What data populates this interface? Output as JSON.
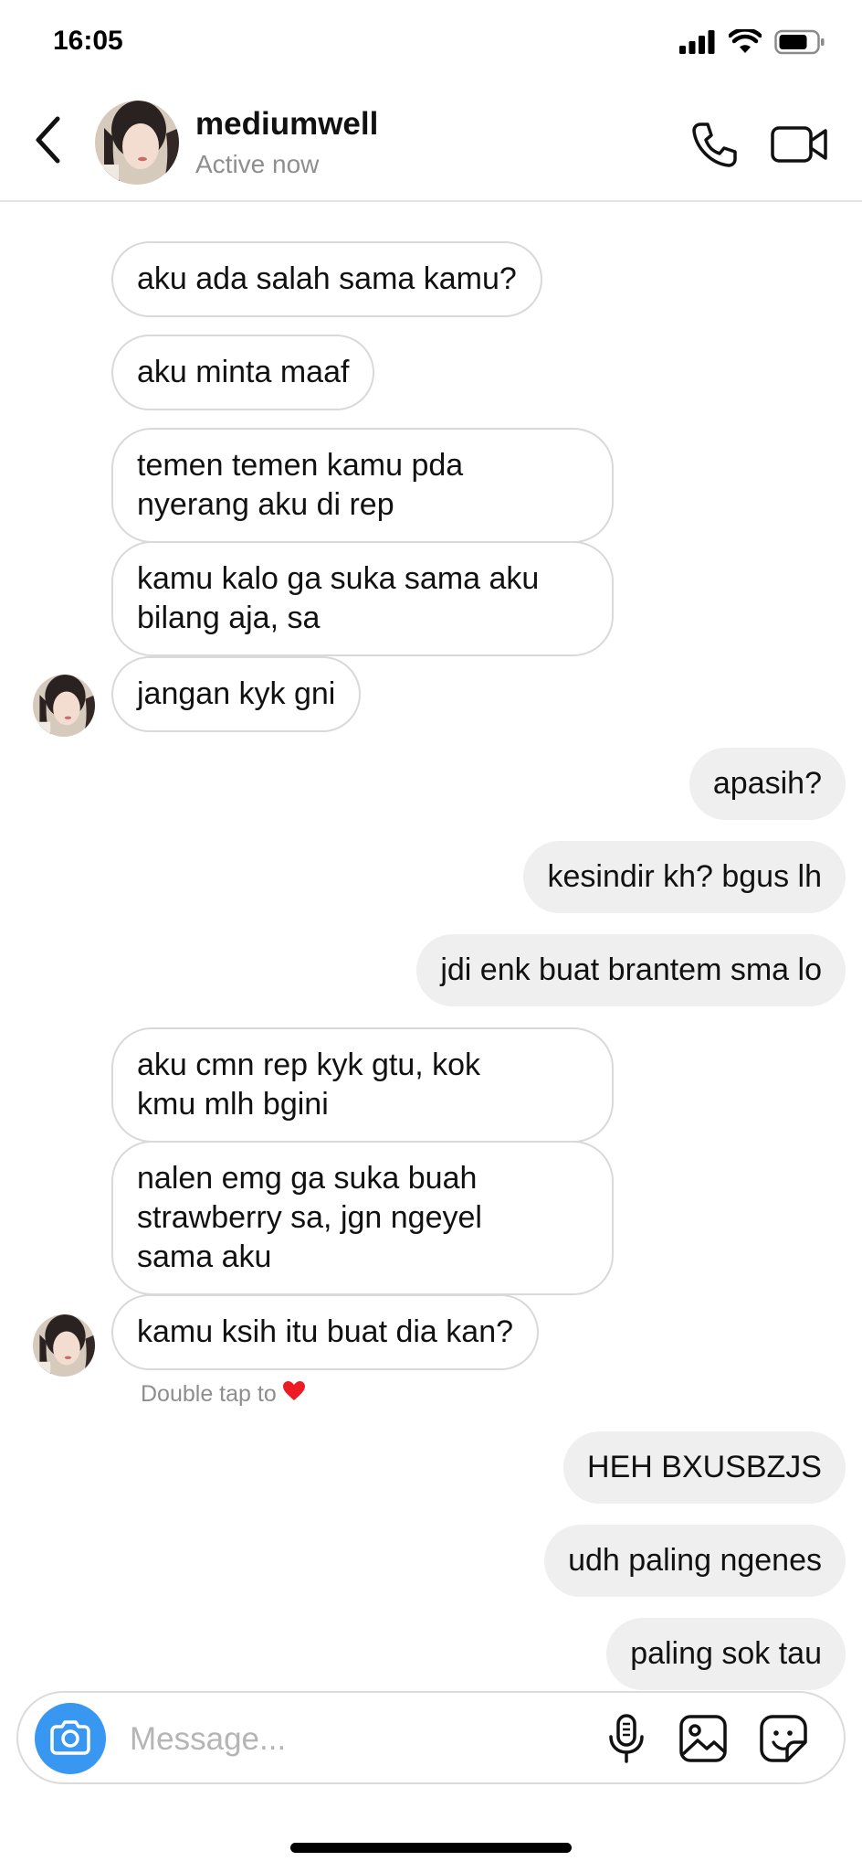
{
  "status_bar": {
    "time": "16:05",
    "icons": [
      "signal-icon",
      "wifi-icon",
      "battery-icon"
    ]
  },
  "header": {
    "username": "mediumwell",
    "status": "Active now",
    "icons": [
      "back-icon",
      "phone-icon",
      "video-camera-icon"
    ]
  },
  "messages": [
    {
      "direction": "in",
      "text": "aku ada salah sama kamu?"
    },
    {
      "direction": "in",
      "text": "aku minta maaf"
    },
    {
      "direction": "in",
      "text": "temen temen kamu pda\nnyerang aku di rep"
    },
    {
      "direction": "in",
      "text": "kamu kalo ga suka sama aku\nbilang aja, sa"
    },
    {
      "direction": "in",
      "text": "jangan kyk gni"
    },
    {
      "direction": "out",
      "text": "apasih?"
    },
    {
      "direction": "out",
      "text": "kesindir kh? bgus lh"
    },
    {
      "direction": "out",
      "text": "jdi enk buat brantem sma lo"
    },
    {
      "direction": "in",
      "text": "aku cmn rep kyk gtu, kok\nkmu mlh bgini"
    },
    {
      "direction": "in",
      "text": "nalen emg ga suka buah\nstrawberry sa, jgn ngeyel\nsama aku"
    },
    {
      "direction": "in",
      "text": "kamu ksih itu buat dia kan?"
    },
    {
      "direction": "out",
      "text": "HEH BXUSBZJS"
    },
    {
      "direction": "out",
      "text": "udh paling ngenes"
    },
    {
      "direction": "out",
      "text": "paling sok tau"
    }
  ],
  "hint": {
    "text": "Double tap to",
    "icon": "heart-icon",
    "heart_color": "#ed1c24"
  },
  "composer": {
    "placeholder": "Message...",
    "value": "",
    "icons": [
      "camera-icon",
      "microphone-icon",
      "gallery-icon",
      "sticker-icon"
    ],
    "camera_color": "#3897f0"
  }
}
